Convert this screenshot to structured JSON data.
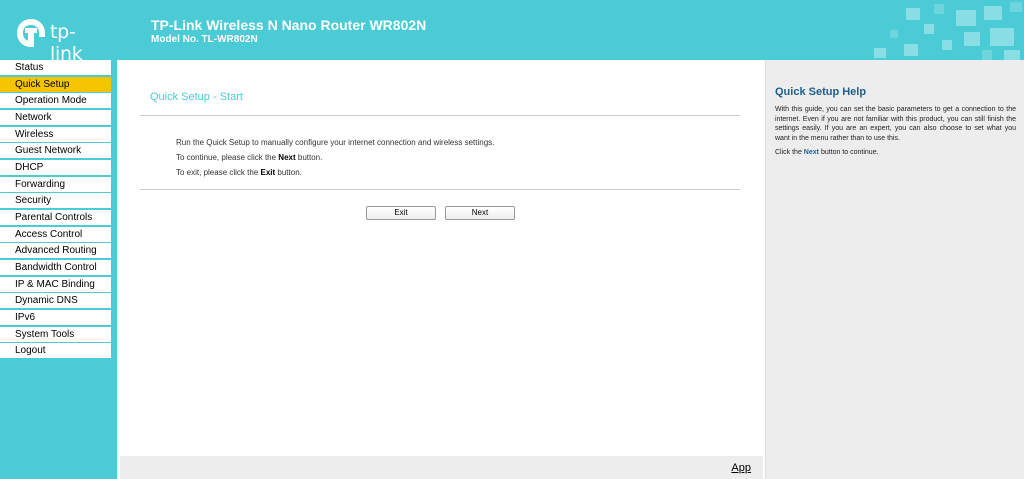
{
  "header": {
    "brand": "tp-link",
    "title": "TP-Link Wireless N Nano Router WR802N",
    "model": "Model No. TL-WR802N",
    "accent_color": "#4acbd6"
  },
  "sidebar": {
    "active_color": "#f5c400",
    "items": [
      {
        "label": "Status"
      },
      {
        "label": "Quick Setup",
        "active": true
      },
      {
        "label": "Operation Mode"
      },
      {
        "label": "Network"
      },
      {
        "label": "Wireless"
      },
      {
        "label": "Guest Network"
      },
      {
        "label": "DHCP"
      },
      {
        "label": "Forwarding"
      },
      {
        "label": "Security"
      },
      {
        "label": "Parental Controls"
      },
      {
        "label": "Access Control"
      },
      {
        "label": "Advanced Routing"
      },
      {
        "label": "Bandwidth Control"
      },
      {
        "label": "IP & MAC Binding"
      },
      {
        "label": "Dynamic DNS"
      },
      {
        "label": "IPv6"
      },
      {
        "label": "System Tools"
      },
      {
        "label": "Logout"
      }
    ]
  },
  "main": {
    "title": "Quick Setup - Start",
    "line1": "Run the Quick Setup to manually configure your internet connection and wireless settings.",
    "line2_pre": "To continue, please click the",
    "line2_bold": "Next",
    "line2_post": "button.",
    "line3_pre": "To exit, please click the",
    "line3_bold": "Exit",
    "line3_post": "button.",
    "exit_label": "Exit",
    "next_label": "Next",
    "footer_link": "App"
  },
  "help": {
    "title": "Quick Setup Help",
    "body": "With this guide, you can set the basic parameters to get a connection to the internet. Even if you are not familiar with this product, you can still finish the settings easily. If you are an expert, you can also choose to set what you want in the menu rather than to use this.",
    "next_pre": "Click the",
    "next_bold": "Next",
    "next_post": "button to continue."
  }
}
